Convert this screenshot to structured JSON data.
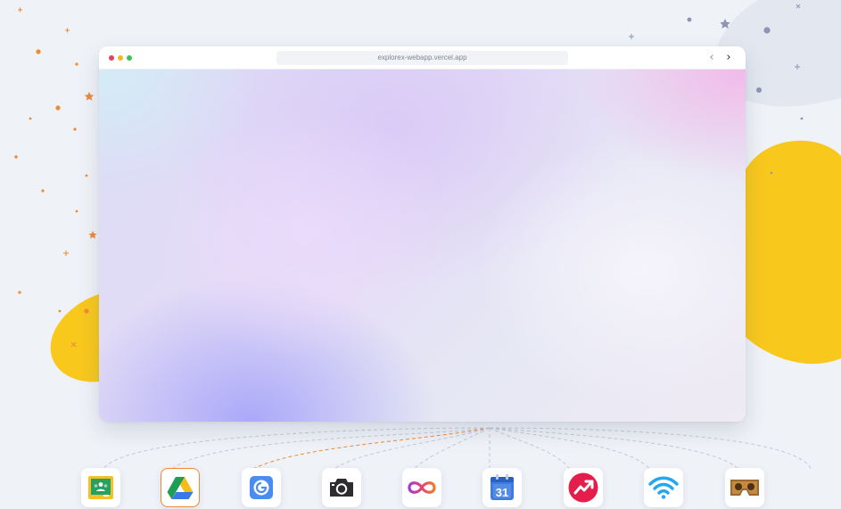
{
  "browser": {
    "url": "explorex-webapp.vercel.app",
    "back_glyph": "‹",
    "forward_glyph": "›"
  },
  "dock": {
    "items": [
      {
        "name": "google-classroom",
        "icon": "classroom-icon",
        "selected": false
      },
      {
        "name": "google-drive",
        "icon": "drive-icon",
        "selected": true
      },
      {
        "name": "google-translate",
        "icon": "g-letter-icon",
        "selected": false
      },
      {
        "name": "camera",
        "icon": "camera-icon",
        "selected": false
      },
      {
        "name": "infinity",
        "icon": "infinity-icon",
        "selected": false
      },
      {
        "name": "google-calendar",
        "icon": "calendar-icon",
        "selected": false
      },
      {
        "name": "trending",
        "icon": "trending-up-icon",
        "selected": false
      },
      {
        "name": "wifi",
        "icon": "wifi-icon",
        "selected": false
      },
      {
        "name": "cardboard-vr",
        "icon": "vr-headset-icon",
        "selected": false
      }
    ],
    "calendar_day": "31"
  },
  "colors": {
    "background": "#eff2f7",
    "blob_yellow": "#f8c81d",
    "accent_orange": "#ee8a3c",
    "dot_red": "#e0455a",
    "dot_yellow": "#f5b62c",
    "dot_green": "#3cc45a"
  }
}
